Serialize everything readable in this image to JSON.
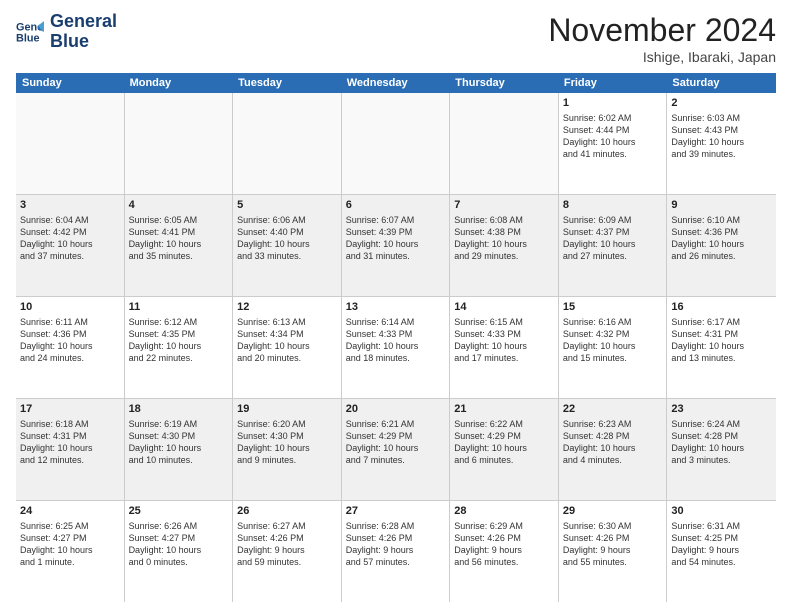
{
  "logo": {
    "line1": "General",
    "line2": "Blue"
  },
  "title": "November 2024",
  "location": "Ishige, Ibaraki, Japan",
  "weekdays": [
    "Sunday",
    "Monday",
    "Tuesday",
    "Wednesday",
    "Thursday",
    "Friday",
    "Saturday"
  ],
  "rows": [
    [
      {
        "day": "",
        "lines": [],
        "empty": true
      },
      {
        "day": "",
        "lines": [],
        "empty": true
      },
      {
        "day": "",
        "lines": [],
        "empty": true
      },
      {
        "day": "",
        "lines": [],
        "empty": true
      },
      {
        "day": "",
        "lines": [],
        "empty": true
      },
      {
        "day": "1",
        "lines": [
          "Sunrise: 6:02 AM",
          "Sunset: 4:44 PM",
          "Daylight: 10 hours",
          "and 41 minutes."
        ],
        "empty": false
      },
      {
        "day": "2",
        "lines": [
          "Sunrise: 6:03 AM",
          "Sunset: 4:43 PM",
          "Daylight: 10 hours",
          "and 39 minutes."
        ],
        "empty": false
      }
    ],
    [
      {
        "day": "3",
        "lines": [
          "Sunrise: 6:04 AM",
          "Sunset: 4:42 PM",
          "Daylight: 10 hours",
          "and 37 minutes."
        ],
        "empty": false
      },
      {
        "day": "4",
        "lines": [
          "Sunrise: 6:05 AM",
          "Sunset: 4:41 PM",
          "Daylight: 10 hours",
          "and 35 minutes."
        ],
        "empty": false
      },
      {
        "day": "5",
        "lines": [
          "Sunrise: 6:06 AM",
          "Sunset: 4:40 PM",
          "Daylight: 10 hours",
          "and 33 minutes."
        ],
        "empty": false
      },
      {
        "day": "6",
        "lines": [
          "Sunrise: 6:07 AM",
          "Sunset: 4:39 PM",
          "Daylight: 10 hours",
          "and 31 minutes."
        ],
        "empty": false
      },
      {
        "day": "7",
        "lines": [
          "Sunrise: 6:08 AM",
          "Sunset: 4:38 PM",
          "Daylight: 10 hours",
          "and 29 minutes."
        ],
        "empty": false
      },
      {
        "day": "8",
        "lines": [
          "Sunrise: 6:09 AM",
          "Sunset: 4:37 PM",
          "Daylight: 10 hours",
          "and 27 minutes."
        ],
        "empty": false
      },
      {
        "day": "9",
        "lines": [
          "Sunrise: 6:10 AM",
          "Sunset: 4:36 PM",
          "Daylight: 10 hours",
          "and 26 minutes."
        ],
        "empty": false
      }
    ],
    [
      {
        "day": "10",
        "lines": [
          "Sunrise: 6:11 AM",
          "Sunset: 4:36 PM",
          "Daylight: 10 hours",
          "and 24 minutes."
        ],
        "empty": false
      },
      {
        "day": "11",
        "lines": [
          "Sunrise: 6:12 AM",
          "Sunset: 4:35 PM",
          "Daylight: 10 hours",
          "and 22 minutes."
        ],
        "empty": false
      },
      {
        "day": "12",
        "lines": [
          "Sunrise: 6:13 AM",
          "Sunset: 4:34 PM",
          "Daylight: 10 hours",
          "and 20 minutes."
        ],
        "empty": false
      },
      {
        "day": "13",
        "lines": [
          "Sunrise: 6:14 AM",
          "Sunset: 4:33 PM",
          "Daylight: 10 hours",
          "and 18 minutes."
        ],
        "empty": false
      },
      {
        "day": "14",
        "lines": [
          "Sunrise: 6:15 AM",
          "Sunset: 4:33 PM",
          "Daylight: 10 hours",
          "and 17 minutes."
        ],
        "empty": false
      },
      {
        "day": "15",
        "lines": [
          "Sunrise: 6:16 AM",
          "Sunset: 4:32 PM",
          "Daylight: 10 hours",
          "and 15 minutes."
        ],
        "empty": false
      },
      {
        "day": "16",
        "lines": [
          "Sunrise: 6:17 AM",
          "Sunset: 4:31 PM",
          "Daylight: 10 hours",
          "and 13 minutes."
        ],
        "empty": false
      }
    ],
    [
      {
        "day": "17",
        "lines": [
          "Sunrise: 6:18 AM",
          "Sunset: 4:31 PM",
          "Daylight: 10 hours",
          "and 12 minutes."
        ],
        "empty": false
      },
      {
        "day": "18",
        "lines": [
          "Sunrise: 6:19 AM",
          "Sunset: 4:30 PM",
          "Daylight: 10 hours",
          "and 10 minutes."
        ],
        "empty": false
      },
      {
        "day": "19",
        "lines": [
          "Sunrise: 6:20 AM",
          "Sunset: 4:30 PM",
          "Daylight: 10 hours",
          "and 9 minutes."
        ],
        "empty": false
      },
      {
        "day": "20",
        "lines": [
          "Sunrise: 6:21 AM",
          "Sunset: 4:29 PM",
          "Daylight: 10 hours",
          "and 7 minutes."
        ],
        "empty": false
      },
      {
        "day": "21",
        "lines": [
          "Sunrise: 6:22 AM",
          "Sunset: 4:29 PM",
          "Daylight: 10 hours",
          "and 6 minutes."
        ],
        "empty": false
      },
      {
        "day": "22",
        "lines": [
          "Sunrise: 6:23 AM",
          "Sunset: 4:28 PM",
          "Daylight: 10 hours",
          "and 4 minutes."
        ],
        "empty": false
      },
      {
        "day": "23",
        "lines": [
          "Sunrise: 6:24 AM",
          "Sunset: 4:28 PM",
          "Daylight: 10 hours",
          "and 3 minutes."
        ],
        "empty": false
      }
    ],
    [
      {
        "day": "24",
        "lines": [
          "Sunrise: 6:25 AM",
          "Sunset: 4:27 PM",
          "Daylight: 10 hours",
          "and 1 minute."
        ],
        "empty": false
      },
      {
        "day": "25",
        "lines": [
          "Sunrise: 6:26 AM",
          "Sunset: 4:27 PM",
          "Daylight: 10 hours",
          "and 0 minutes."
        ],
        "empty": false
      },
      {
        "day": "26",
        "lines": [
          "Sunrise: 6:27 AM",
          "Sunset: 4:26 PM",
          "Daylight: 9 hours",
          "and 59 minutes."
        ],
        "empty": false
      },
      {
        "day": "27",
        "lines": [
          "Sunrise: 6:28 AM",
          "Sunset: 4:26 PM",
          "Daylight: 9 hours",
          "and 57 minutes."
        ],
        "empty": false
      },
      {
        "day": "28",
        "lines": [
          "Sunrise: 6:29 AM",
          "Sunset: 4:26 PM",
          "Daylight: 9 hours",
          "and 56 minutes."
        ],
        "empty": false
      },
      {
        "day": "29",
        "lines": [
          "Sunrise: 6:30 AM",
          "Sunset: 4:26 PM",
          "Daylight: 9 hours",
          "and 55 minutes."
        ],
        "empty": false
      },
      {
        "day": "30",
        "lines": [
          "Sunrise: 6:31 AM",
          "Sunset: 4:25 PM",
          "Daylight: 9 hours",
          "and 54 minutes."
        ],
        "empty": false
      }
    ]
  ]
}
